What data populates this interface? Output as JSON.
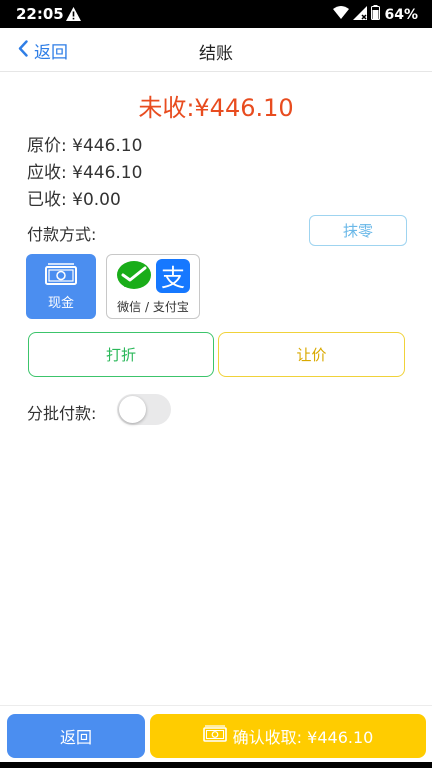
{
  "status_bar": {
    "time": "22:05",
    "battery": "64%"
  },
  "nav": {
    "back_label": "返回",
    "title": "结账"
  },
  "summary": {
    "due_text": "未收:¥446.10",
    "original_price": "原价: ¥446.10",
    "receivable": "应收: ¥446.10",
    "received": "已收: ¥0.00"
  },
  "payment": {
    "label": "付款方式:",
    "round_off_label": "抹零",
    "methods": [
      {
        "label": "现金",
        "icon": "cash-icon",
        "selected": true
      },
      {
        "label": "微信 / 支付宝",
        "icon": "wechat-alipay-icon",
        "selected": false
      }
    ]
  },
  "actions": {
    "discount_label": "打折",
    "concession_label": "让价"
  },
  "batch": {
    "label": "分批付款:",
    "enabled": false
  },
  "bottom": {
    "back_label": "返回",
    "confirm_label": "确认收取: ¥446.10"
  },
  "colors": {
    "accent_blue": "#4b8ef0",
    "due_red": "#e84c1f",
    "confirm_yellow": "#ffcc00",
    "green": "#2bb85a"
  }
}
